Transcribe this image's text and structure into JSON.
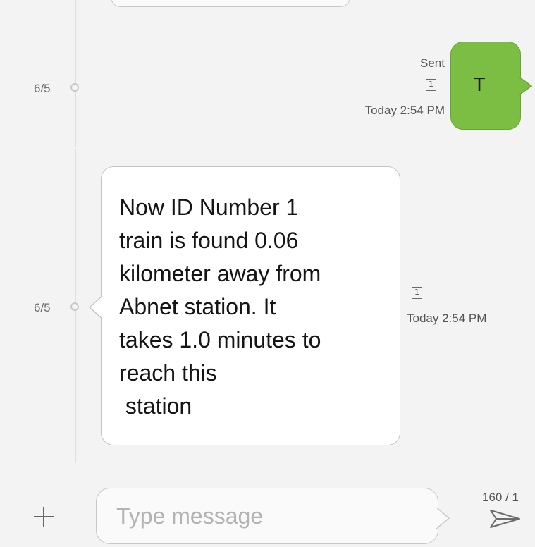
{
  "conversation": {
    "messages": [
      {
        "direction": "sent",
        "date": "6/5",
        "status": "Sent",
        "sim": "1",
        "time": "Today 2:54 PM",
        "text": "T",
        "bubble_color": "#7cbe43"
      },
      {
        "direction": "received",
        "date": "6/5",
        "sim": "1",
        "time": "Today 2:54 PM",
        "text": "Now ID Number 1\ntrain is found 0.06\nkilometer away from\nAbnet station. It\ntakes 1.0 minutes to\nreach this\n station",
        "bubble_color": "#ffffff"
      }
    ]
  },
  "composer": {
    "placeholder": "Type message",
    "counter": "160 / 1",
    "add_icon": "plus-icon",
    "send_icon": "send-icon"
  }
}
